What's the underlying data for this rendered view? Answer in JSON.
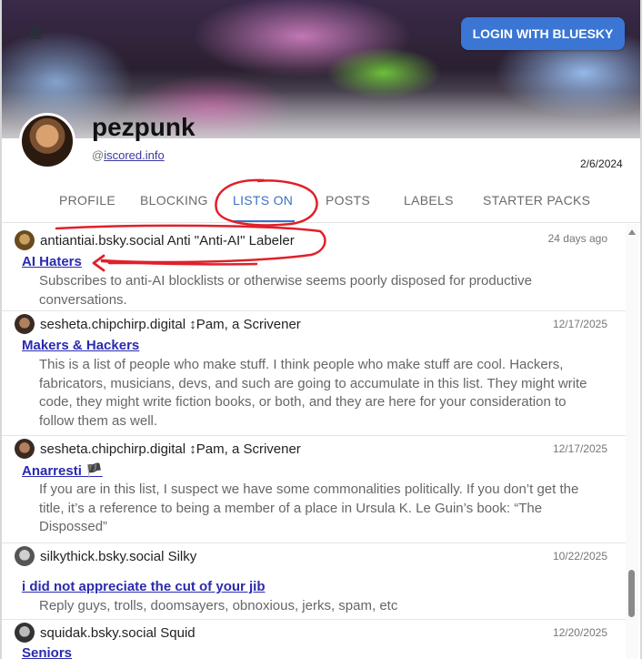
{
  "header": {
    "login_label": "LOGIN WITH BLUESKY"
  },
  "profile": {
    "name": "pezpunk",
    "handle_prefix": "@",
    "handle_domain": "iscored.info",
    "date": "2/6/2024"
  },
  "tabs": [
    {
      "label": "PROFILE"
    },
    {
      "label": "BLOCKING"
    },
    {
      "label": "LISTS ON",
      "active": true
    },
    {
      "label": "POSTS"
    },
    {
      "label": "LABELS"
    },
    {
      "label": "STARTER PACKS"
    }
  ],
  "lists": [
    {
      "owner": "antiantiai.bsky.social Anti \"Anti-AI\" Labeler",
      "date": "24 days ago",
      "title": "AI Haters",
      "description": "Subscribes to anti-AI blocklists or otherwise seems poorly disposed for productive conversations."
    },
    {
      "owner": "sesheta.chipchirp.digital ↕Pam, a Scrivener",
      "date": "12/17/2025",
      "title": "Makers & Hackers",
      "description": "This is a list of people who make stuff. I think people who make stuff are cool. Hackers, fabricators, musicians, devs, and such are going to accumulate in this list. They might write code, they might write fiction books, or both, and they are here for your consideration to follow them as well."
    },
    {
      "owner": "sesheta.chipchirp.digital ↕Pam, a Scrivener",
      "date": "12/17/2025",
      "title": "Anarresti 🏴",
      "description": "If you are in this list, I suspect we have some commonalities politically. If you don’t get the title, it’s a reference to being a member of a place in Ursula K. Le Guin’s book: “The Dispossed”"
    },
    {
      "owner": "silkythick.bsky.social Silky",
      "date": "10/22/2025",
      "title": "i did not appreciate the cut of your jib",
      "description": "Reply guys, trolls, doomsayers, obnoxious, jerks, spam, etc"
    },
    {
      "owner": "squidak.bsky.social Squid",
      "date": "12/20/2025",
      "title": "Seniors",
      "description": ""
    }
  ],
  "colors": {
    "accent": "#3b6fc8",
    "login_button": "#3b76d4",
    "list_title": "#2a2ab0",
    "annotation": "#e0202a"
  }
}
